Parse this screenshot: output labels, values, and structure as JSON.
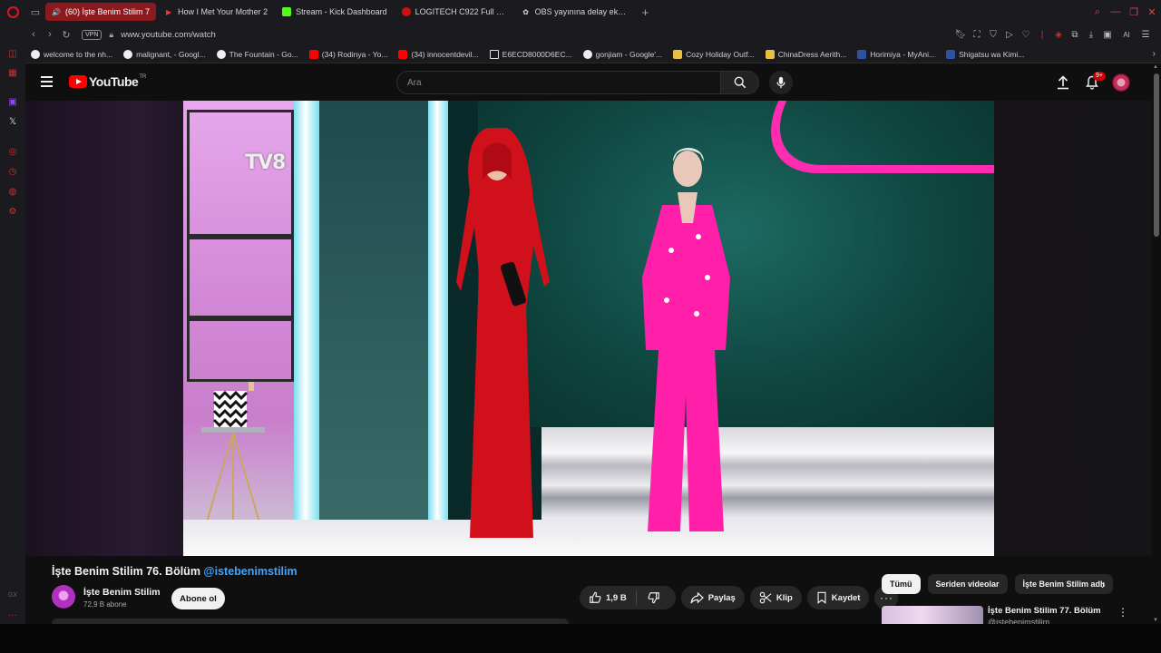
{
  "browser": {
    "tabs": [
      {
        "label": "(60) İşte Benim Stilim 7",
        "active": true,
        "icon": "speaker-icon"
      },
      {
        "label": "How I Met Your Mother 2",
        "active": false,
        "icon": "youtube-icon"
      },
      {
        "label": "Stream - Kick Dashboard",
        "active": false,
        "icon": "kick-icon"
      },
      {
        "label": "LOGITECH C922 Full HD 1",
        "active": false,
        "icon": "logitech-icon"
      },
      {
        "label": "OBS yayınına delay eklem",
        "active": false,
        "icon": "chatgpt-icon"
      }
    ],
    "new_tab_label": "+",
    "address": {
      "vpn_label": "VPN",
      "url": "www.youtube.com/watch"
    },
    "toolbar_ai_label": "AI",
    "bookmarks": [
      {
        "label": "welcome to the nh...",
        "color": "#eeeeee"
      },
      {
        "label": "malignant, - Googl...",
        "color": "#eeeeee"
      },
      {
        "label": "The Fountain - Go...",
        "color": "#eeeeee"
      },
      {
        "label": "(34) Rodinya - Yo...",
        "color": "#ff0000"
      },
      {
        "label": "(34) innocentdevil...",
        "color": "#ff0000"
      },
      {
        "label": "E6ECD8000D6EC...",
        "color": "#dddddd"
      },
      {
        "label": "gonjiam - Google'...",
        "color": "#eeeeee"
      },
      {
        "label": "Cozy Holiday Outf...",
        "color": "#e8c040"
      },
      {
        "label": "ChinaDress Aerith...",
        "color": "#e8c040"
      },
      {
        "label": "Horimiya - MyAni...",
        "color": "#2e51a2"
      },
      {
        "label": "Shigatsu wa Kimi...",
        "color": "#2e51a2"
      }
    ],
    "sidebar_bottom_label": "GX"
  },
  "youtube": {
    "logo_text": "YouTube",
    "country_code": "TR",
    "search_placeholder": "Ara",
    "notification_badge": "9+",
    "video": {
      "watermark": "TV8",
      "title": "İşte Benim Stilim 76. Bölüm",
      "hashtag": "@istebenimstilim",
      "channel_name": "İşte Benim Stilim",
      "subscribers": "72,9 B abone",
      "subscribe_label": "Abone ol",
      "like_count": "1,9 B",
      "share_label": "Paylaş",
      "clip_label": "Klip",
      "save_label": "Kaydet",
      "more_label": "···"
    },
    "chips": [
      {
        "label": "Tümü",
        "active": true
      },
      {
        "label": "Seriden videolar",
        "active": false
      },
      {
        "label": "İşte Benim Stilim adlı",
        "active": false
      }
    ],
    "recommendation": {
      "title": "İşte Benim Stilim 77. Bölüm",
      "channel": "@istebenimstilim"
    }
  },
  "colors": {
    "accent_red": "#ff0000",
    "opera_red": "#e0141e",
    "link_blue": "#3ea6ff",
    "presenter_red": "#d0101a",
    "presenter_pink": "#ff1fa8"
  }
}
